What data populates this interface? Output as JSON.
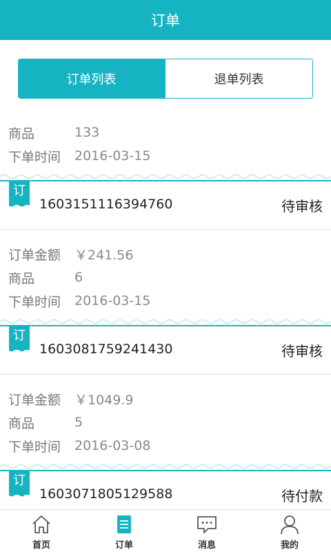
{
  "header": {
    "title": "订单"
  },
  "tabs": [
    {
      "label": "订单列表",
      "active": true
    },
    {
      "label": "退单列表",
      "active": false
    }
  ],
  "first_partial": {
    "rows": [
      {
        "label": "商品",
        "value": "133"
      },
      {
        "label": "下单时间",
        "value": "2016-03-15"
      }
    ]
  },
  "orders": [
    {
      "tag": "订",
      "number": "1603151116394760",
      "status": "待审核",
      "rows": [
        {
          "label": "订单金额",
          "value": "￥241.56"
        },
        {
          "label": "商品",
          "value": "6"
        },
        {
          "label": "下单时间",
          "value": "2016-03-15"
        }
      ]
    },
    {
      "tag": "订",
      "number": "1603081759241430",
      "status": "待审核",
      "rows": [
        {
          "label": "订单金额",
          "value": "￥1049.9"
        },
        {
          "label": "商品",
          "value": "5"
        },
        {
          "label": "下单时间",
          "value": "2016-03-08"
        }
      ]
    },
    {
      "tag": "订",
      "number": "1603071805129588",
      "status": "待付款"
    }
  ],
  "bottom_nav": [
    {
      "label": "首页",
      "icon": "home-icon"
    },
    {
      "label": "订单",
      "icon": "order-list-icon",
      "active": true
    },
    {
      "label": "消息",
      "icon": "message-icon"
    },
    {
      "label": "我的",
      "icon": "user-icon"
    }
  ],
  "colors": {
    "accent": "#16b4c2"
  }
}
